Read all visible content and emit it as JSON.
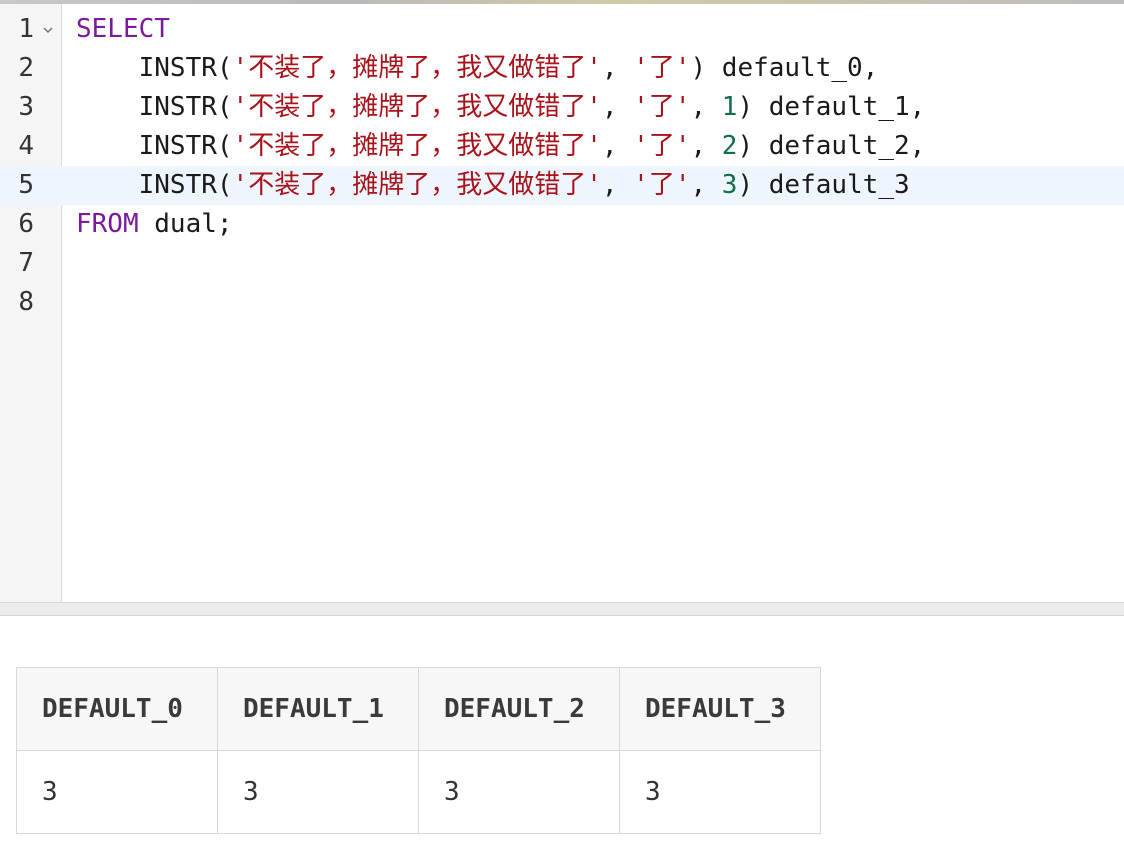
{
  "editor": {
    "active_line": 5,
    "line_numbers": [
      "1",
      "2",
      "3",
      "4",
      "5",
      "6",
      "7",
      "8"
    ],
    "lines": [
      {
        "tokens": [
          {
            "t": "SELECT",
            "c": "kw"
          }
        ]
      },
      {
        "tokens": [
          {
            "t": "    INSTR(",
            "c": "pl"
          },
          {
            "t": "'不装了，摊牌了，我又做错了'",
            "c": "str"
          },
          {
            "t": ", ",
            "c": "pl"
          },
          {
            "t": "'了'",
            "c": "str"
          },
          {
            "t": ") default_0,",
            "c": "pl"
          }
        ]
      },
      {
        "tokens": [
          {
            "t": "    INSTR(",
            "c": "pl"
          },
          {
            "t": "'不装了，摊牌了，我又做错了'",
            "c": "str"
          },
          {
            "t": ", ",
            "c": "pl"
          },
          {
            "t": "'了'",
            "c": "str"
          },
          {
            "t": ", ",
            "c": "pl"
          },
          {
            "t": "1",
            "c": "num"
          },
          {
            "t": ") default_1,",
            "c": "pl"
          }
        ]
      },
      {
        "tokens": [
          {
            "t": "    INSTR(",
            "c": "pl"
          },
          {
            "t": "'不装了，摊牌了，我又做错了'",
            "c": "str"
          },
          {
            "t": ", ",
            "c": "pl"
          },
          {
            "t": "'了'",
            "c": "str"
          },
          {
            "t": ", ",
            "c": "pl"
          },
          {
            "t": "2",
            "c": "num"
          },
          {
            "t": ") default_2,",
            "c": "pl"
          }
        ]
      },
      {
        "tokens": [
          {
            "t": "    INSTR(",
            "c": "pl"
          },
          {
            "t": "'不装了，摊牌了，我又做错了'",
            "c": "str"
          },
          {
            "t": ", ",
            "c": "pl"
          },
          {
            "t": "'了'",
            "c": "str"
          },
          {
            "t": ", ",
            "c": "pl"
          },
          {
            "t": "3",
            "c": "num"
          },
          {
            "t": ") default_3",
            "c": "pl"
          }
        ]
      },
      {
        "tokens": [
          {
            "t": "FROM",
            "c": "kw"
          },
          {
            "t": " dual;",
            "c": "pl"
          }
        ]
      },
      {
        "tokens": []
      },
      {
        "tokens": []
      }
    ],
    "fold_icon": "chevron-down-icon"
  },
  "results": {
    "columns": [
      "DEFAULT_0",
      "DEFAULT_1",
      "DEFAULT_2",
      "DEFAULT_3"
    ],
    "rows": [
      [
        "3",
        "3",
        "3",
        "3"
      ]
    ]
  },
  "colors": {
    "keyword": "#7a1c9a",
    "string": "#a8121b",
    "number": "#116d4a",
    "active_line_bg": "#eef5fc"
  }
}
